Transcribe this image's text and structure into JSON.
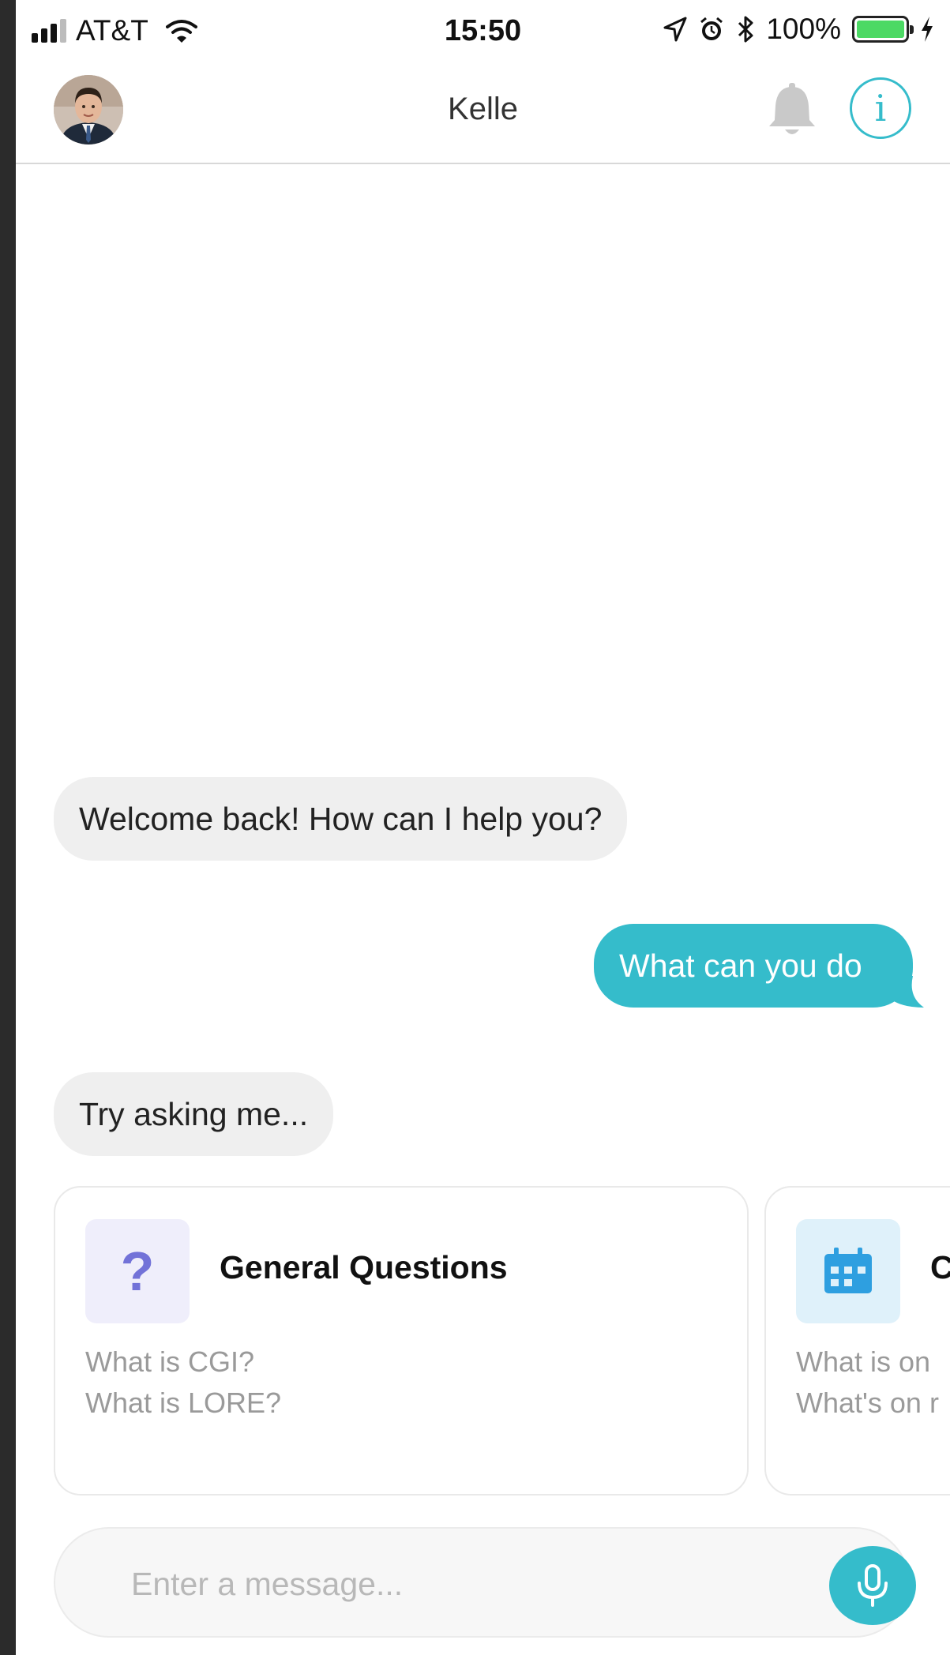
{
  "status_bar": {
    "carrier": "AT&T",
    "time": "15:50",
    "battery": "100%",
    "battery_level": 1.0,
    "signal_bars_active": 3,
    "signal_bars_total": 4
  },
  "header": {
    "title": "Kelle"
  },
  "messages": [
    {
      "from": "bot",
      "text": "Welcome back! How can I help you?"
    },
    {
      "from": "user",
      "text": "What can you do"
    },
    {
      "from": "bot",
      "text": "Try asking me..."
    }
  ],
  "suggestions": [
    {
      "icon": "question-mark-icon",
      "icon_glyph": "?",
      "title": "General Questions",
      "examples": [
        "What is CGI?",
        "What is LORE?"
      ]
    },
    {
      "icon": "calendar-icon",
      "title": "C",
      "examples": [
        "What is on",
        "What's on r"
      ]
    }
  ],
  "composer": {
    "placeholder": "Enter a message..."
  },
  "colors": {
    "accent": "#35bccb",
    "bot_bubble": "#efefef",
    "question_icon": "#7272d8",
    "calendar_icon": "#2e9fe0",
    "battery_fill": "#4cd964"
  }
}
